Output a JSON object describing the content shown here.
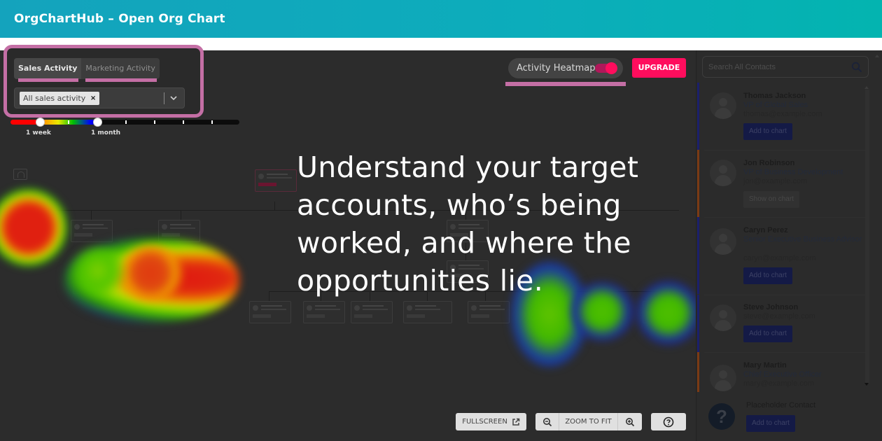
{
  "app": {
    "title": "OrgChartHub – Open Org Chart"
  },
  "activity": {
    "tabs": [
      {
        "label": "Sales Activity",
        "active": true
      },
      {
        "label": "Marketing Activity",
        "active": false
      }
    ],
    "filter_chip": "All sales activity",
    "chip_remove": "×"
  },
  "time_slider": {
    "labels": [
      "1 week",
      "1 month"
    ],
    "range_start_label": "1 week",
    "range_end_label": "1 month"
  },
  "heatmap_toggle": {
    "label": "Activity Heatmap",
    "on": true
  },
  "upgrade_label": "UPGRADE",
  "headline": "Understand your target accounts, who’s being worked, and where the opportunities lie.",
  "controls": {
    "fullscreen": "FULLSCREEN",
    "zoom_to_fit": "ZOOM TO FIT"
  },
  "sidebar": {
    "search_placeholder": "Search All Contacts",
    "contacts": [
      {
        "name": "Thomas Jackson",
        "role": "VP of Global Sales",
        "email": "thomas@example.com",
        "action": "Add to chart",
        "accent": "#1a1f6b"
      },
      {
        "name": "Jon Robinson",
        "role": "VP of Business Development",
        "email": "jon@example.com",
        "action": "Show on chart",
        "accent": "#7a3a14"
      },
      {
        "name": "Caryn Perez",
        "role": "Senior Executive Business Advisor",
        "email": "caryn@example.com",
        "action": "Add to chart",
        "accent": "#1a1f6b"
      },
      {
        "name": "Steve Johnson",
        "role": "",
        "email": "steve@example.com",
        "action": "Add to chart",
        "accent": "#1a1f6b"
      },
      {
        "name": "Mary Martin",
        "role": "Chief Executive Officer",
        "email": "mary@example.com",
        "action": "",
        "accent": "#7a3a14"
      }
    ],
    "placeholder": {
      "name": "Placeholder Contact",
      "action": "Add to chart",
      "icon": "?"
    }
  },
  "colors": {
    "accent_pink": "#ff0d5d",
    "highlight": "#c46fa5",
    "header_teal": "#0cadbb"
  }
}
